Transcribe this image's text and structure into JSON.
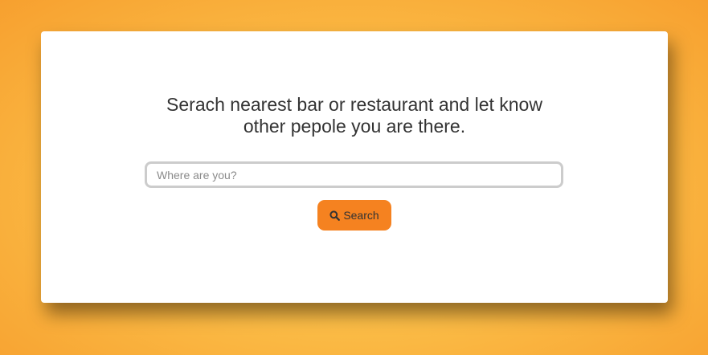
{
  "hero": {
    "title_line1": "Serach nearest bar or restaurant and let know",
    "title_line2": "other pepole you are there."
  },
  "search": {
    "placeholder": "Where are you?",
    "value": "",
    "button_label": "Search",
    "button_icon": "search-icon"
  },
  "colors": {
    "accent": "#f58220",
    "background": "#fbbd47",
    "text": "#333333"
  }
}
